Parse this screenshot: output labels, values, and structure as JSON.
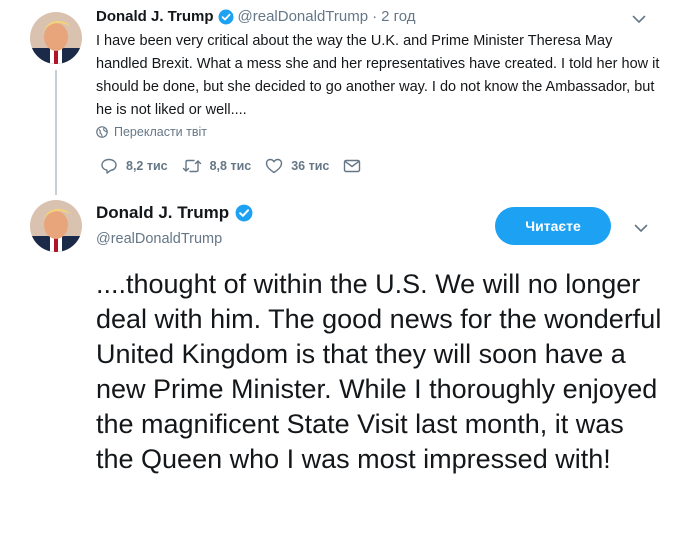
{
  "tweet1": {
    "name": "Donald J. Trump",
    "handle": "@realDonaldTrump",
    "separator": "·",
    "time": "2 год",
    "text": "I have been very critical about the way the U.K. and Prime Minister Theresa May handled Brexit. What a mess she and her representatives have created. I told her how it should be done, but she decided to go another way. I do not know the Ambassador, but he is not liked or well....",
    "translate_label": "Перекласти твіт",
    "replies": "8,2 тис",
    "retweets": "8,8 тис",
    "likes": "36 тис"
  },
  "tweet2": {
    "name": "Donald J. Trump",
    "handle": "@realDonaldTrump",
    "follow_label": "Читаєте",
    "text": "....thought of within the U.S. We will no longer deal with him. The good news for the wonderful United Kingdom is that they will soon have a new Prime Minister. While I thoroughly enjoyed the magnificent State Visit last month, it was the Queen who I was most impressed with!"
  },
  "colors": {
    "accent": "#1da1f2",
    "secondary_text": "#657786",
    "primary_text": "#14171a"
  },
  "icons": {
    "verified": "verified-badge-icon",
    "caret": "chevron-down-icon",
    "globe": "globe-icon",
    "reply": "reply-icon",
    "retweet": "retweet-icon",
    "like": "heart-icon",
    "message": "envelope-icon"
  }
}
